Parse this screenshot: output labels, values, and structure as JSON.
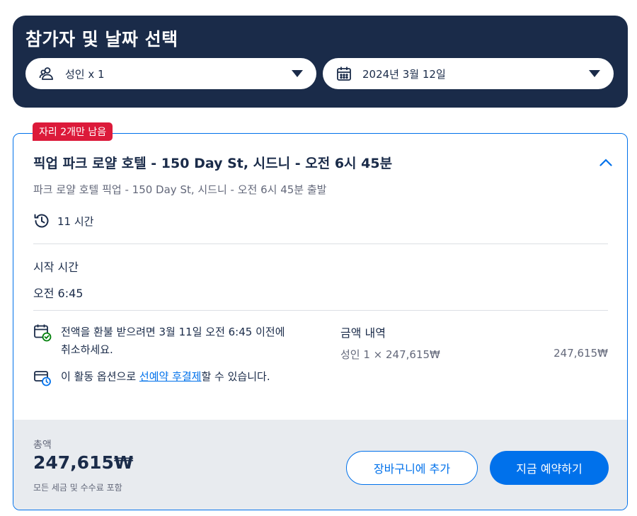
{
  "selector": {
    "title": "참가자 및 날짜 선택",
    "participants": {
      "icon": "people-icon",
      "value": "성인 x 1"
    },
    "date": {
      "icon": "calendar-icon",
      "value": "2024년 3월 12일"
    }
  },
  "option": {
    "badge": "자리 2개만 남음",
    "title": "픽업 파크 로얄 호텔 - 150 Day St, 시드니 - 오전 6시 45분",
    "subtitle": "파크 로얄 호텔 픽업 - 150 Day St, 시드니 - 오전 6시 45분 출발",
    "duration": "11 시간",
    "start_label": "시작 시간",
    "start_value": "오전 6:45",
    "cancel_policy": "전액을 환불 받으려면 3월 11일 오전 6:45 이전에 취소하세요.",
    "reserve_prefix": "이 활동 옵션으로 ",
    "reserve_link": "선예약 후결제",
    "reserve_suffix": "할 수 있습니다.",
    "price_breakdown": {
      "heading": "금액 내역",
      "line_label": "성인 1 × 247,615₩",
      "line_amount": "247,615₩"
    }
  },
  "footer": {
    "total_label": "총액",
    "total_value": "247,615₩",
    "total_note": "모든 세금 및 수수료 포함",
    "add_to_cart": "장바구니에 추가",
    "book_now": "지금 예약하기"
  },
  "colors": {
    "navy": "#1a2b49",
    "accent": "#0071eb",
    "badge": "#dc1a3a",
    "footer_bg": "#e8ebef",
    "success": "#008009"
  }
}
